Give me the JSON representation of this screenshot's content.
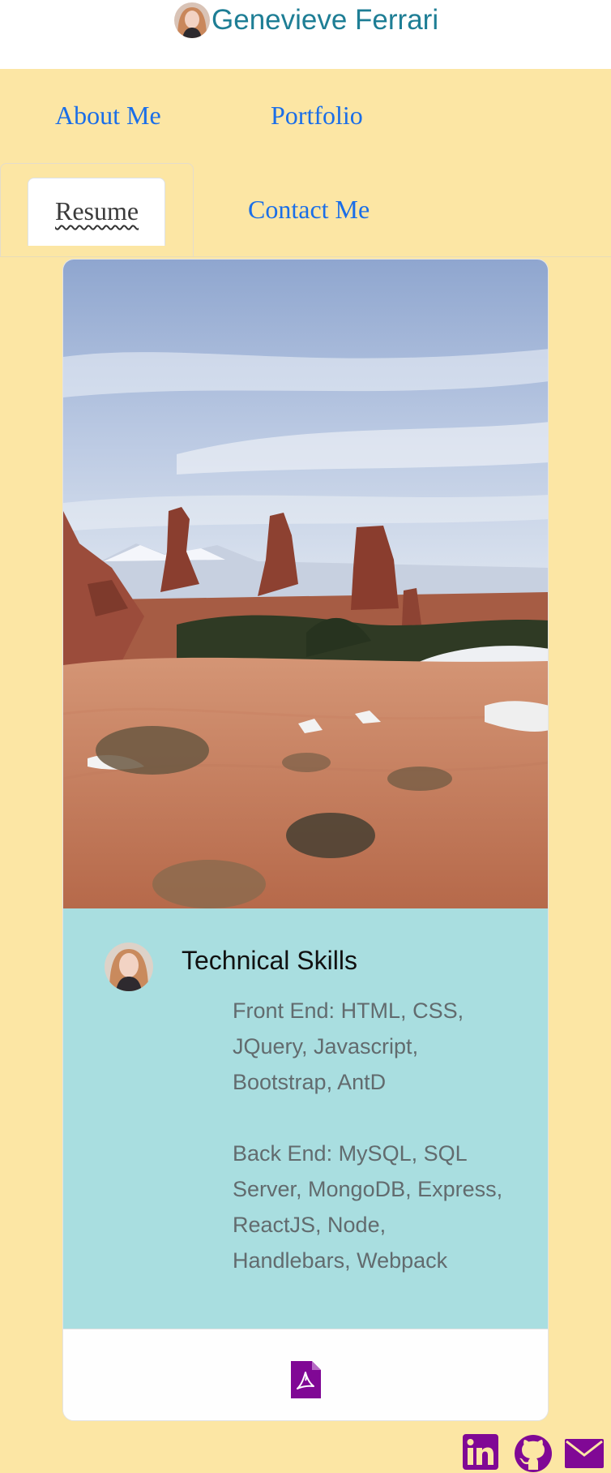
{
  "header": {
    "name": "Genevieve Ferrari"
  },
  "nav": {
    "items": [
      {
        "label": "About Me",
        "active": false
      },
      {
        "label": "Portfolio",
        "active": false
      },
      {
        "label": "Resume",
        "active": true
      },
      {
        "label": "Contact Me",
        "active": false
      }
    ]
  },
  "card": {
    "image_icon": "desert-landscape-photo",
    "title": "Technical Skills",
    "front_end": "Front End: HTML, CSS, JQuery, Javascript, Bootstrap, AntD",
    "back_end": "Back End: MySQL, SQL Server, MongoDB, Express, ReactJS, Node, Handlebars, Webpack",
    "footer_icon": "pdf-file-icon"
  },
  "social": [
    {
      "name": "linkedin-icon"
    },
    {
      "name": "github-icon"
    },
    {
      "name": "mail-icon"
    }
  ],
  "colors": {
    "page_background": "#fce6a4",
    "header_name": "#1e7e95",
    "nav_link": "#1a6ee8",
    "card_body": "#a9dee0",
    "icon_purple": "#800895"
  }
}
